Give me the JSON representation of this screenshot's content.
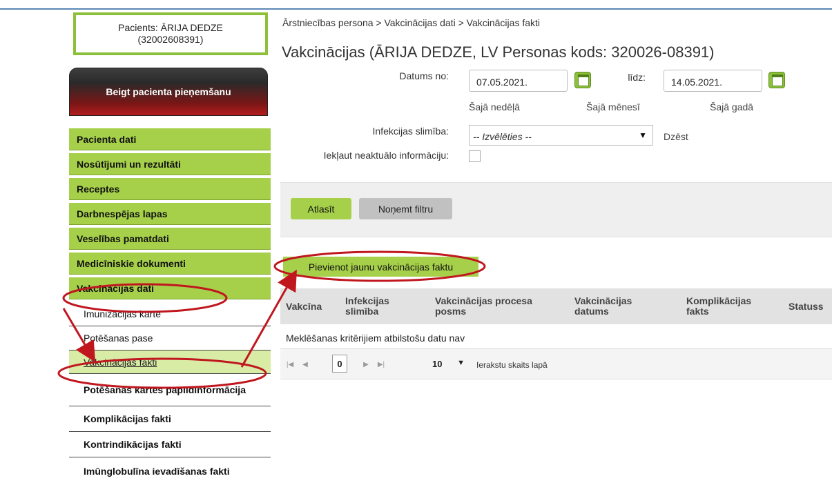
{
  "patient": {
    "line1": "Pacients: ĀRIJA DEDZE",
    "line2": "(32002608391)"
  },
  "end_button": "Beigt pacienta pieņemšanu",
  "menu": [
    "Pacienta dati",
    "Nosūtījumi un rezultāti",
    "Receptes",
    "Darbnespējas lapas",
    "Veselības pamatdati",
    "Medicīniskie dokumenti",
    "Vakcinācijas dati"
  ],
  "submenu": [
    "Imunizācijas karte",
    "Potēšanas pase",
    "Vakcinācijas fakti",
    "Potēšanas kartes papildinformācija",
    "Komplikācijas fakti",
    "Kontrindikācijas fakti",
    "Imūnglobulīna ievadīšanas fakti"
  ],
  "breadcrumb": "Ārstniecības persona > Vakcinācijas dati > Vakcinācijas fakti",
  "title": "Vakcinācijas (ĀRIJA DEDZE, LV Personas kods: 320026-08391)",
  "filters": {
    "date_from_label": "Datums no:",
    "date_from": "07.05.2021.",
    "date_to_label": "līdz:",
    "date_to": "14.05.2021.",
    "this_week": "Šajā nedēļā",
    "this_month": "Šajā mēnesī",
    "this_year": "Šajā gadā",
    "disease_label": "Infekcijas slimība:",
    "disease_placeholder": "-- Izvēlēties --",
    "clear": "Dzēst",
    "include_label": "Iekļaut neaktuālo informāciju:"
  },
  "buttons": {
    "select": "Atlasīt",
    "remove_filter": "Noņemt filtru",
    "add": "Pievienot jaunu vakcinācijas faktu"
  },
  "table": {
    "headers": [
      "Vakcīna",
      "Infekcijas slimība",
      "Vakcinācijas procesa posms",
      "Vakcinācijas datums",
      "Komplikācijas fakts",
      "Statuss"
    ],
    "empty": "Meklēšanas kritērijiem atbilstošu datu nav"
  },
  "pager": {
    "page": "0",
    "page_size": "10",
    "page_size_label": "Ierakstu skaits lapā"
  },
  "colors": {
    "accent_green": "#a6d04a",
    "annotation_red": "#c0171f"
  }
}
